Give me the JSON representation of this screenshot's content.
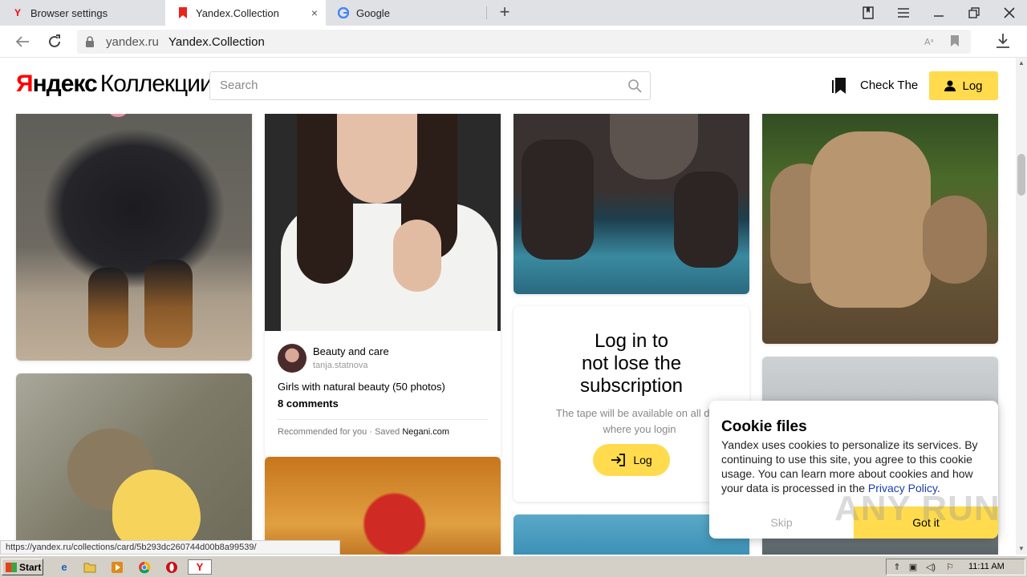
{
  "browser": {
    "tabs": [
      {
        "label": "Browser settings",
        "favicon": "yandex-y-icon"
      },
      {
        "label": "Yandex.Collection",
        "favicon": "bookmark-red-icon",
        "active": true
      },
      {
        "label": "Google",
        "favicon": "google-g-icon"
      }
    ],
    "close_glyph": "×",
    "new_tab_glyph": "+",
    "address": {
      "domain": "yandex.ru",
      "title": "Yandex.Collection"
    },
    "status_url": "https://yandex.ru/collections/card/5b293dc260744d00b8a99539/"
  },
  "header": {
    "logo_ya": "Я",
    "logo_rest": "ндекс",
    "logo_collections": "Коллекции",
    "search_placeholder": "Search",
    "check_label": "Check The",
    "login_label": "Log"
  },
  "feed": {
    "featured_card": {
      "title": "Beauty and care",
      "user": "tanja.statnova",
      "description": "Girls with natural beauty (50 photos)",
      "comments": "8 comments",
      "recommended": "Recommended for you",
      "saved_prefix": "Saved",
      "saved_source": "Negani.com"
    },
    "login_card": {
      "title_line1": "Log in to",
      "title_line2": "not lose the",
      "title_line3": "subscription",
      "subtitle_line1": "The tape will be available on all devi",
      "subtitle_line2": "where you login",
      "button_label": "Log"
    }
  },
  "cookie": {
    "title": "Cookie files",
    "text": "Yandex uses cookies to personalize its services. By continuing to use this site, you agree to this cookie usage. You can learn more about cookies and how your data is processed in the",
    "link": "Privacy Policy",
    "period": ".",
    "skip": "Skip",
    "got_it": "Got it"
  },
  "watermark": "ANY RUN",
  "taskbar": {
    "start": "Start",
    "clock": "11:11 AM"
  },
  "colors": {
    "accent_yellow": "#ffdb4d",
    "yandex_red": "#ff0000",
    "link_blue": "#1a3dad"
  }
}
